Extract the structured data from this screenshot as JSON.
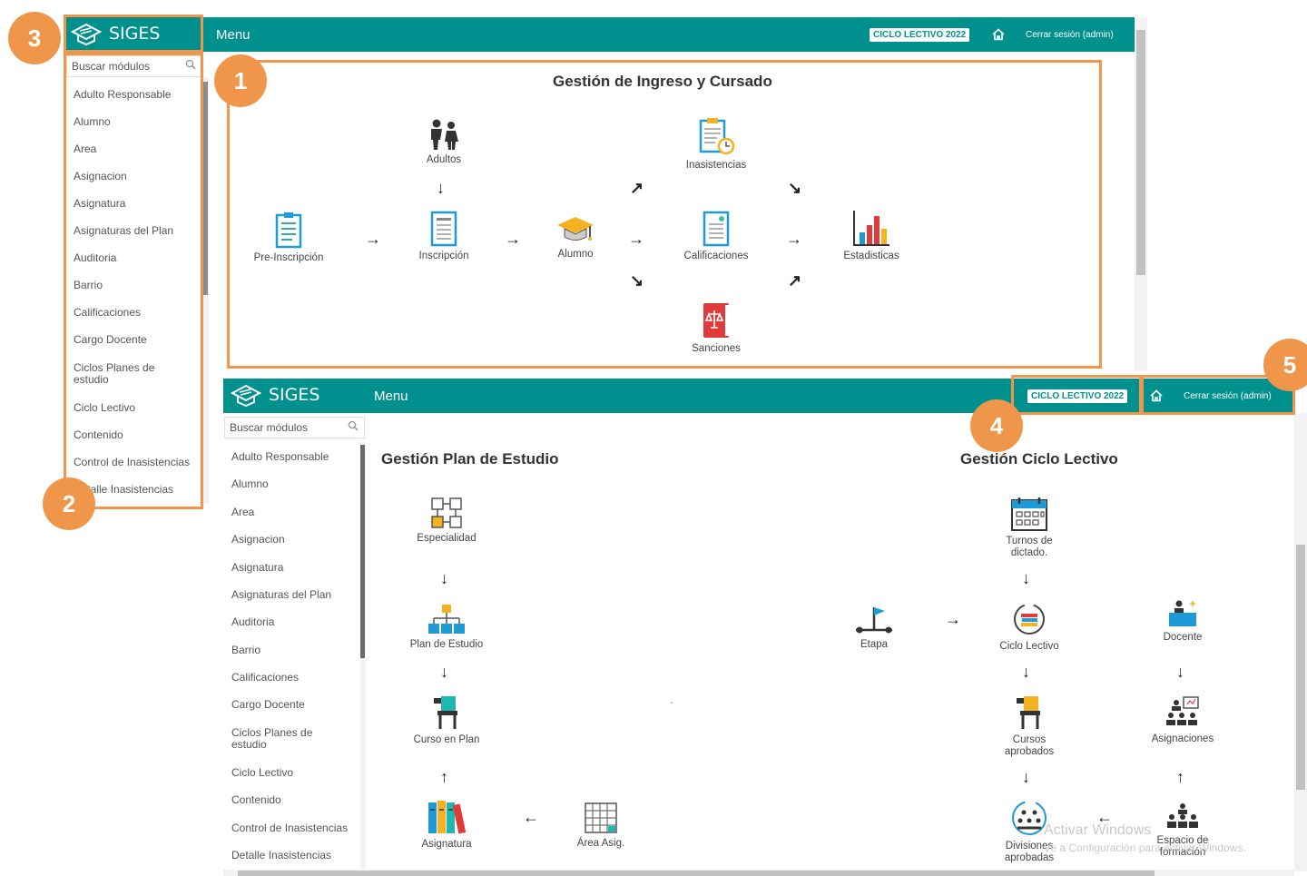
{
  "app": {
    "name": "SIGES",
    "menu_title": "Menu",
    "ciclo_badge": "CICLO LECTIVO 2022",
    "logout_label": "Cerrar sesión (admin)",
    "search_placeholder": "Buscar módulos",
    "accent": "#00908d",
    "callout": "#f0964a"
  },
  "sidebar_items": [
    "Adulto Responsable",
    "Alumno",
    "Area",
    "Asignacion",
    "Asignatura",
    "Asignaturas del Plan",
    "Auditoria",
    "Barrio",
    "Calificaciones",
    "Cargo Docente",
    "Ciclos Planes de estudio",
    "Ciclo Lectivo",
    "Contenido",
    "Control de Inasistencias",
    "Detalle Inasistencias"
  ],
  "top_section": {
    "title": "Gestión de Ingreso y Cursado",
    "nodes": {
      "pre": "Pre-Inscripción",
      "adultos": "Adultos",
      "inscripcion": "Inscripción",
      "alumno": "Alumno",
      "inasistencias": "Inasistencias",
      "calificaciones": "Calificaciones",
      "sanciones": "Sanciones",
      "estadisticas": "Estadisticas"
    }
  },
  "plan_section": {
    "title": "Gestión Plan de Estudio",
    "nodes": {
      "especialidad": "Especialidad",
      "plan": "Plan de Estudio",
      "curso": "Curso en Plan",
      "asignatura": "Asignatura",
      "area": "Área Asig."
    }
  },
  "ciclo_section": {
    "title": "Gestión Ciclo Lectivo",
    "nodes": {
      "turnos": "Turnos de dictado.",
      "etapa": "Etapa",
      "ciclo": "Ciclo Lectivo",
      "cursos": "Cursos aprobados",
      "divisiones": "Divisiones aprobadas",
      "docente": "Docente",
      "asignaciones": "Asignaciones",
      "espacio": "Espacio de formación"
    }
  },
  "stray_dash": "-",
  "watermark": {
    "line1": "Activar Windows",
    "line2": "Ve a Configuración para activar Windows."
  },
  "callouts": [
    "1",
    "2",
    "3",
    "4",
    "5"
  ]
}
